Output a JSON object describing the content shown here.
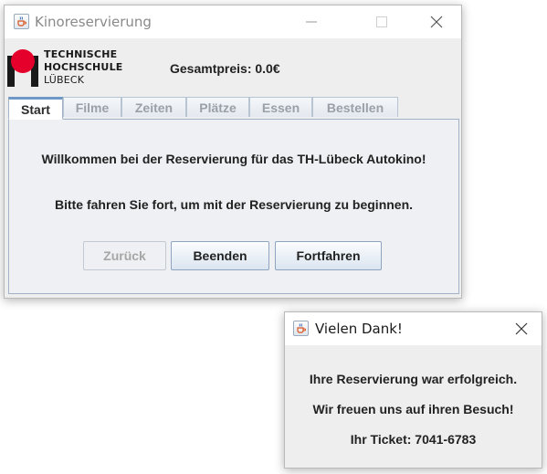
{
  "main_window": {
    "title": "Kinoreservierung",
    "logo": {
      "line1": "TECHNISCHE",
      "line2": "HOCHSCHULE",
      "line3": "LÜBECK"
    },
    "total_price_label": "Gesamtpreis: 0.0€",
    "tabs": [
      {
        "label": "Start",
        "active": true
      },
      {
        "label": "Filme",
        "active": false
      },
      {
        "label": "Zeiten",
        "active": false
      },
      {
        "label": "Plätze",
        "active": false
      },
      {
        "label": "Essen",
        "active": false
      },
      {
        "label": "Bestellen",
        "active": false
      }
    ],
    "panel": {
      "welcome": "Willkommen bei der Reservierung für das TH-Lübeck Autokino!",
      "instruction": "Bitte fahren Sie fort, um mit der Reservierung zu beginnen."
    },
    "buttons": {
      "back": "Zurück",
      "quit": "Beenden",
      "continue": "Fortfahren"
    }
  },
  "dialog": {
    "title": "Vielen Dank!",
    "line1": "Ihre Reservierung war erfolgreich.",
    "line2": "Wir freuen uns auf ihren Besuch!",
    "ticket": "Ihr Ticket: 7041-6783"
  },
  "colors": {
    "logo_red": "#e4002b",
    "tab_accent": "#6e98c6",
    "disabled_text": "#a6a6a6"
  }
}
